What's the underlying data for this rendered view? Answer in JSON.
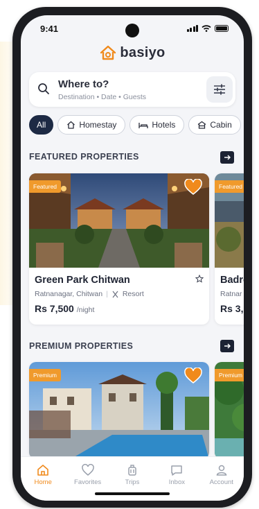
{
  "status_bar": {
    "time": "9:41"
  },
  "brand": {
    "name": "basiyo",
    "accent": "#f08a1c",
    "icon": "house-logo-icon"
  },
  "search": {
    "title": "Where to?",
    "subtitle": "Destination  •  Date  •  Guests",
    "icon": "search-icon",
    "filter_icon": "sliders-icon"
  },
  "categories": [
    {
      "label": "All",
      "icon": null,
      "active": true
    },
    {
      "label": "Homestay",
      "icon": "home-icon",
      "active": false
    },
    {
      "label": "Hotels",
      "icon": "bed-icon",
      "active": false
    },
    {
      "label": "Cabin",
      "icon": "cabin-icon",
      "active": false
    }
  ],
  "featured": {
    "title": "FEATURED PROPERTIES",
    "cards": [
      {
        "badge": "Featured",
        "name": "Green Park Chitwan",
        "location": "Ratnanagar, Chitwan",
        "type": "Resort",
        "price": "Rs 7,500",
        "per": "/night",
        "favorited": true
      },
      {
        "badge": "Featured",
        "name": "Badre",
        "location": "Ratnar",
        "price": "Rs 3,",
        "favorited": false
      }
    ]
  },
  "premium": {
    "title": "PREMIUM PROPERTIES",
    "cards": [
      {
        "badge": "Premium",
        "favorited": true
      },
      {
        "badge": "Premium",
        "favorited": false
      }
    ]
  },
  "tabs": [
    {
      "label": "Home",
      "icon": "home-icon",
      "active": true
    },
    {
      "label": "Favorites",
      "icon": "heart-icon",
      "active": false
    },
    {
      "label": "Trips",
      "icon": "luggage-icon",
      "active": false
    },
    {
      "label": "Inbox",
      "icon": "chat-icon",
      "active": false
    },
    {
      "label": "Account",
      "icon": "user-icon",
      "active": false
    }
  ],
  "colors": {
    "badge": "#f09a2c",
    "active_chip": "#1d2a44",
    "active_tab": "#f08a1c"
  }
}
